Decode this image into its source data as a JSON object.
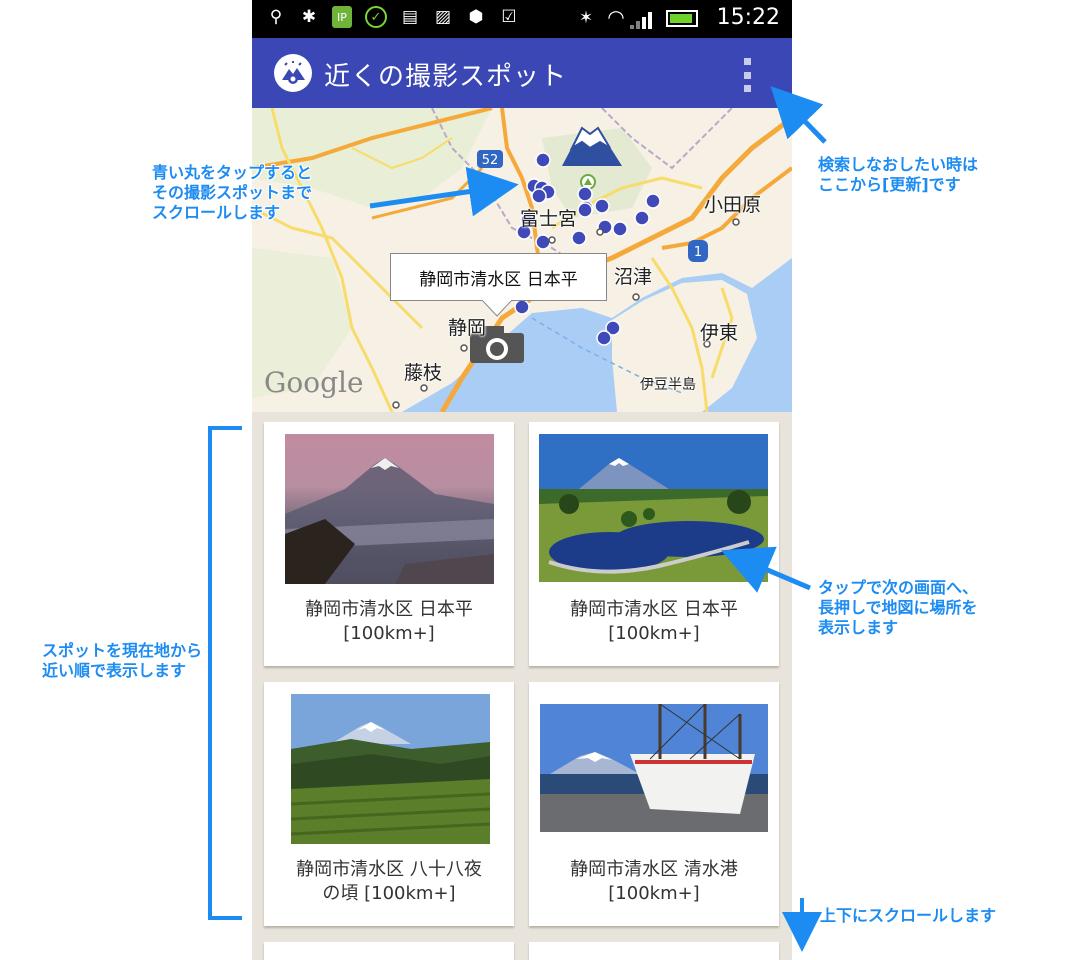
{
  "status_bar": {
    "time": "15:22",
    "icons": [
      "usb-icon",
      "android-debug-icon",
      "ip-icon",
      "check-circle-icon",
      "clipboard-icon",
      "image-icon",
      "nfc-icon",
      "download-check-icon",
      "bluetooth-icon",
      "wifi-icon",
      "signal-icon",
      "battery-charging-icon"
    ]
  },
  "app_bar": {
    "title": "近くの撮影スポット",
    "accent_color": "#3a47b5"
  },
  "map": {
    "callout": "静岡市清水区 日本平",
    "labels": {
      "fujinomiya": "富士宮",
      "odawara": "小田原",
      "numazu": "沼津",
      "shizuoka": "静岡",
      "ito": "伊東",
      "fujieda": "藤枝",
      "izu_hanto": "伊豆半島",
      "route_52": "52",
      "route_1": "1"
    },
    "attribution": "Google"
  },
  "spots": [
    {
      "name": "静岡市清水区 日本平",
      "distance": "[100km+]"
    },
    {
      "name": "静岡市清水区 日本平",
      "distance": "[100km+]"
    },
    {
      "name": "静岡市清水区 八十八夜",
      "name_line2": "の頃 [100km+]"
    },
    {
      "name": "静岡市清水区 清水港",
      "distance": "[100km+]"
    }
  ],
  "annotations": {
    "blue_circle": [
      "青い丸をタップすると",
      "その撮影スポットまで",
      "スクロールします"
    ],
    "refresh": [
      "検索しなおしたい時は",
      "ここから[更新]です"
    ],
    "tap_card": [
      "タップで次の画面へ、",
      "長押しで地図に場所を",
      "表示します"
    ],
    "order": [
      "スポットを現在地から",
      "近い順で表示します"
    ],
    "scroll": "上下にスクロールします",
    "color": "#1d8cf2"
  }
}
